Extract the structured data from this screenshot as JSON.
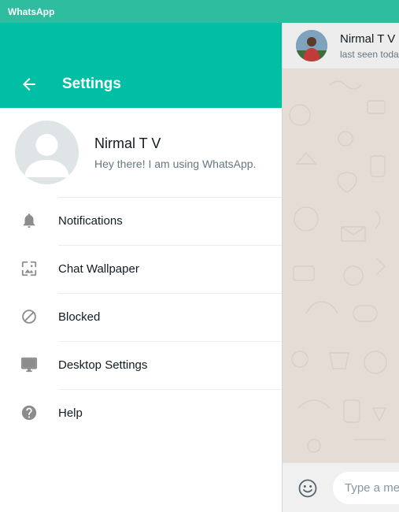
{
  "window": {
    "title": "WhatsApp"
  },
  "settings": {
    "title": "Settings",
    "profile": {
      "name": "Nirmal T V",
      "status": "Hey there! I am using WhatsApp."
    },
    "menu": [
      {
        "label": "Notifications",
        "icon": "bell-icon"
      },
      {
        "label": "Chat Wallpaper",
        "icon": "wallpaper-icon"
      },
      {
        "label": "Blocked",
        "icon": "blocked-icon"
      },
      {
        "label": "Desktop Settings",
        "icon": "monitor-icon"
      },
      {
        "label": "Help",
        "icon": "help-icon"
      }
    ]
  },
  "chat": {
    "contact_name": "Nirmal T V",
    "last_seen": "last seen today",
    "input_placeholder": "Type a message"
  },
  "colors": {
    "titlebar": "#2ebd9f",
    "header_accent": "#00bfa5",
    "chat_background": "#e5ddd5",
    "icon": "#8c8c8c"
  }
}
